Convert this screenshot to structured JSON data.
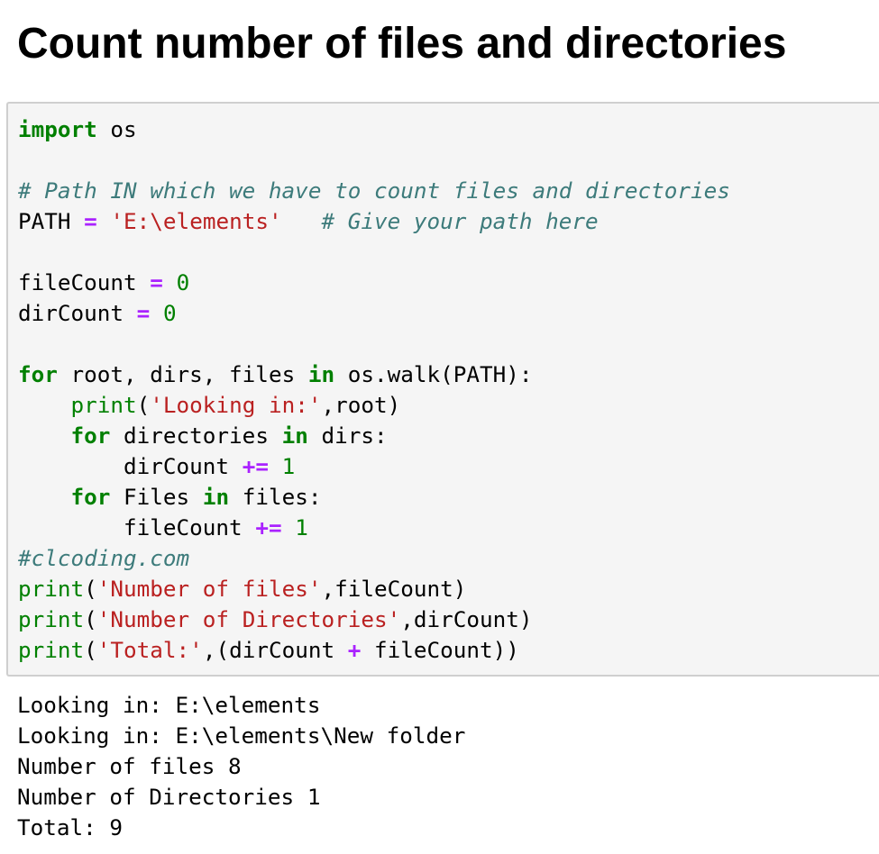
{
  "page": {
    "title": "Count number of files and directories"
  },
  "colors": {
    "keyword": "#008000",
    "builtin": "#008000",
    "operator": "#aa22ff",
    "number": "#008000",
    "string": "#ba2121",
    "comment": "#3d7b7b",
    "cell_background": "#f5f5f5",
    "cell_border": "#cfcfcf"
  },
  "code": {
    "lines": [
      [
        {
          "t": "import",
          "c": "kw"
        },
        {
          "t": " os"
        }
      ],
      [],
      [
        {
          "t": "# Path IN which we have to count files and directories",
          "c": "cmt"
        }
      ],
      [
        {
          "t": "PATH "
        },
        {
          "t": "=",
          "c": "op"
        },
        {
          "t": " "
        },
        {
          "t": "'E:\\elements'",
          "c": "str"
        },
        {
          "t": "   "
        },
        {
          "t": "# Give your path here",
          "c": "cmt"
        }
      ],
      [],
      [
        {
          "t": "fileCount "
        },
        {
          "t": "=",
          "c": "op"
        },
        {
          "t": " "
        },
        {
          "t": "0",
          "c": "num"
        }
      ],
      [
        {
          "t": "dirCount "
        },
        {
          "t": "=",
          "c": "op"
        },
        {
          "t": " "
        },
        {
          "t": "0",
          "c": "num"
        }
      ],
      [],
      [
        {
          "t": "for",
          "c": "kw"
        },
        {
          "t": " root, dirs, files "
        },
        {
          "t": "in",
          "c": "kw"
        },
        {
          "t": " os.walk(PATH):"
        }
      ],
      [
        {
          "t": "    "
        },
        {
          "t": "print",
          "c": "bi"
        },
        {
          "t": "("
        },
        {
          "t": "'Looking in:'",
          "c": "str"
        },
        {
          "t": ",root)"
        }
      ],
      [
        {
          "t": "    "
        },
        {
          "t": "for",
          "c": "kw"
        },
        {
          "t": " directories "
        },
        {
          "t": "in",
          "c": "kw"
        },
        {
          "t": " dirs:"
        }
      ],
      [
        {
          "t": "        dirCount "
        },
        {
          "t": "+=",
          "c": "op"
        },
        {
          "t": " "
        },
        {
          "t": "1",
          "c": "num"
        }
      ],
      [
        {
          "t": "    "
        },
        {
          "t": "for",
          "c": "kw"
        },
        {
          "t": " Files "
        },
        {
          "t": "in",
          "c": "kw"
        },
        {
          "t": " files:"
        }
      ],
      [
        {
          "t": "        fileCount "
        },
        {
          "t": "+=",
          "c": "op"
        },
        {
          "t": " "
        },
        {
          "t": "1",
          "c": "num"
        }
      ],
      [
        {
          "t": "#clcoding.com",
          "c": "cmt"
        }
      ],
      [
        {
          "t": "print",
          "c": "bi"
        },
        {
          "t": "("
        },
        {
          "t": "'Number of files'",
          "c": "str"
        },
        {
          "t": ",fileCount)"
        }
      ],
      [
        {
          "t": "print",
          "c": "bi"
        },
        {
          "t": "("
        },
        {
          "t": "'Number of Directories'",
          "c": "str"
        },
        {
          "t": ",dirCount)"
        }
      ],
      [
        {
          "t": "print",
          "c": "bi"
        },
        {
          "t": "("
        },
        {
          "t": "'Total:'",
          "c": "str"
        },
        {
          "t": ",(dirCount "
        },
        {
          "t": "+",
          "c": "op"
        },
        {
          "t": " fileCount))"
        }
      ]
    ]
  },
  "output": {
    "lines": [
      "Looking in: E:\\elements",
      "Looking in: E:\\elements\\New folder",
      "Number of files 8",
      "Number of Directories 1",
      "Total: 9"
    ]
  }
}
